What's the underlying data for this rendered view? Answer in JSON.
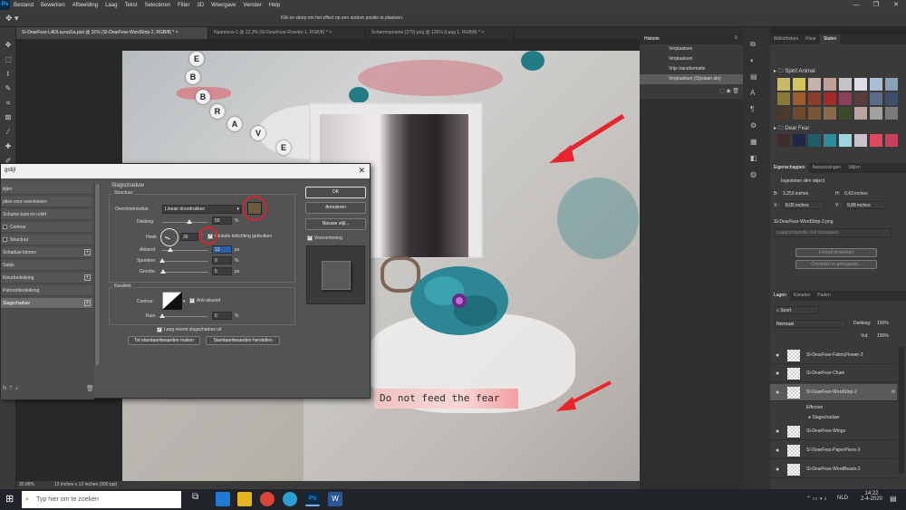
{
  "menubar": {
    "logo": "Ps",
    "items": [
      "Bestand",
      "Bewerken",
      "Afbeelding",
      "Laag",
      "Tekst",
      "Selecteren",
      "Filter",
      "3D",
      "Weergave",
      "Venster",
      "Help"
    ],
    "window_controls": [
      "—",
      "❐",
      "✕"
    ]
  },
  "options": {
    "tool_icon": "move-tool-icon",
    "hint": "Klik en sleep om het effect op een andere positie te plaatsen."
  },
  "doc_tabs": [
    {
      "label": "SI-DearFear-LADLayout1a.psd @ 31% (SI-DearFear-WordStrip-2, RGB/8) *",
      "close": "×"
    },
    {
      "label": "Naamloos-1 @ 22,3% (SI-DearFear-Rosette-1, RGB/8) *",
      "close": "×"
    },
    {
      "label": "Schermopname (279).png @ 126% (Laag 1, RGB/8) *",
      "close": "×"
    }
  ],
  "artwork": {
    "beads_top": [
      "B",
      "E"
    ],
    "beads_brave": [
      "B",
      "R",
      "A",
      "V",
      "E"
    ],
    "strip_text": "Do not feed the fear",
    "arrow_color": "#e8242c"
  },
  "dialog": {
    "title": "gstijl",
    "close": "✕",
    "styles_list": [
      {
        "label": "tijlen",
        "check": false,
        "plus": false
      },
      {
        "label": "pties voor overvloeien",
        "check": false,
        "plus": false
      },
      {
        "label": "Schuine kant en reliëf",
        "check": false,
        "plus": false
      },
      {
        "label": "Contour",
        "check": true,
        "plus": false
      },
      {
        "label": "Structuur",
        "check": true,
        "plus": false
      },
      {
        "label": "Schaduw binnen",
        "check": false,
        "plus": true
      },
      {
        "label": "Satijn",
        "check": false,
        "plus": false
      },
      {
        "label": "Kleurbedekking",
        "check": false,
        "plus": true
      },
      {
        "label": "Patroonbedekking",
        "check": false,
        "plus": false
      },
      {
        "label": "Slagschaduw",
        "check": false,
        "plus": true,
        "selected": true
      }
    ],
    "section_title": "Slagschaduw",
    "structure": {
      "legend": "Structuur",
      "blend_mode_label": "Overvloeimodus:",
      "blend_mode_value": "Lineair doordrukken",
      "shadow_color": "#6e5a3f",
      "opacity_label": "Dekking:",
      "opacity_value": "59",
      "opacity_unit": "%",
      "opacity_level": 0.59,
      "angle_label": "Hoek:",
      "angle_value": "26",
      "angle_unit": "°",
      "global_light_label": "Globale belichting gebruiken",
      "global_light_checked": "✓",
      "distance_label": "Afstand:",
      "distance_value": "13",
      "distance_unit": "px",
      "distance_level": 0.18,
      "spread_label": "Spreiden:",
      "spread_value": "0",
      "spread_unit": "%",
      "size_label": "Grootte:",
      "size_value": "5",
      "size_unit": "px"
    },
    "quality": {
      "legend": "Kwaliteit",
      "contour_label": "Contour:",
      "anti_alias_label": "Anti-aliased",
      "anti_alias_checked": "✓",
      "noise_label": "Ruis:",
      "noise_value": "0",
      "noise_unit": "%"
    },
    "knockout_label": "Laag neemt slagschaduw uit",
    "knockout_checked": "✓",
    "make_default": "Tot standaardwaarden maken",
    "reset_default": "Standaardwaarden herstellen",
    "ok": "OK",
    "cancel": "Annuleren",
    "new_style": "Nieuwe stijl...",
    "preview_label": "Voorvertoning",
    "preview_checked": "✓"
  },
  "history": {
    "title": "Historie",
    "items": [
      "Verplaatsen",
      "Verplaatsen",
      "Vrije transformatie",
      "Verplaatsen (Opslaan als)"
    ]
  },
  "right": {
    "tabs_top": [
      "Bibliotheken",
      "Kleur",
      "Stalen"
    ],
    "group1": "Spirit Animal",
    "group2": "Dear Fear",
    "swatches1": [
      "#c9b96a",
      "#d3c55e",
      "#c4b1a7",
      "#c39f9a",
      "#c6c4c9",
      "#e1dde8",
      "#abbfd3",
      "#8aa1b7",
      "#8a7a3a",
      "#9c5d2f",
      "#8a3f2e",
      "#a42b2c",
      "#8a3f5b",
      "#5a3c3c",
      "#5c6b8a",
      "#3e4f6a",
      "#4a3a2a",
      "#6b4a2e",
      "#7a5638",
      "#8a6a4a",
      "#3a4a2a",
      "#b8a4a0",
      "#a0a0a0",
      "#7a7a7a"
    ],
    "swatches2": [
      "#3e2c2c",
      "#1f2746",
      "#1f5d6b",
      "#2f8c9a",
      "#9fd6dd",
      "#c9c0cc",
      "#e04a5f",
      "#c9405c"
    ],
    "props_tabs": [
      "Eigenschappen",
      "Aanpassingen",
      "Stijlen"
    ],
    "smart_object": "Ingesloten slim object",
    "w_label": "B:",
    "w_value": "3,253 inches",
    "h_label": "H:",
    "h_value": "0,43 inches",
    "x_label": "X:",
    "x_value": "8,05 inches",
    "y_label": "Y:",
    "y_value": "9,88 inches",
    "filename": "SI-DearFear-WordStrip-2.png",
    "comp": "Laagcompositie niet toepassen",
    "edit_content": "Inhoud bewerken",
    "convert": "Omzetten in gekoppeld...",
    "layers_tabs": [
      "Lagen",
      "Kanalen",
      "Paden"
    ],
    "layers_search": "Soort",
    "blend": "Normaal",
    "opacity_label": "Dekking:",
    "opacity_value": "100%",
    "fill_label": "Vul:",
    "fill_value": "100%",
    "layers": [
      {
        "name": "SI-DearFear-FabricFlower-3"
      },
      {
        "name": "SI-DearFear-Chain"
      },
      {
        "name": "SI-DearFear-WordStrip-2",
        "selected": true,
        "fx": "fx"
      },
      {
        "name": "SI-DearFear-Wings"
      },
      {
        "name": "SI-DearFear-PaperPiece-3"
      },
      {
        "name": "SI-DearFear-WordBeads-2"
      }
    ],
    "effects_label": "Effecten",
    "effect_item": "Slagschaduw"
  },
  "status": {
    "zoom": "30,86%",
    "doc": "12 inches x 12 inches (300 ppi)"
  },
  "taskbar": {
    "search_placeholder": "Typ hier om te zoeken",
    "lang": "NLD",
    "time": "14:22",
    "date": "2-4-2020"
  }
}
